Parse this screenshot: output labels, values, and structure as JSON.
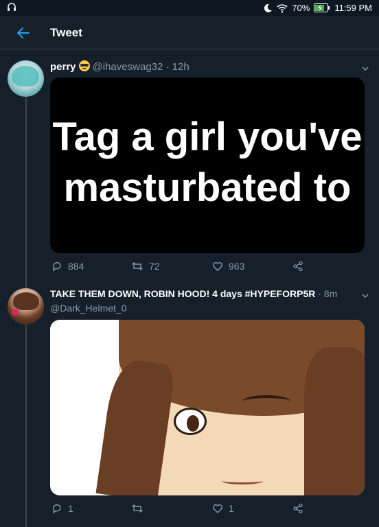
{
  "status": {
    "left_icon": "headphones-icon",
    "battery": "70%",
    "time": "11:59 PM"
  },
  "header": {
    "title": "Tweet"
  },
  "tweets": [
    {
      "name": "perry",
      "handle": "@ihaveswag32",
      "dot": "·",
      "time": "12h",
      "media_text": "Tag a girl you've masturbated to",
      "replies": "884",
      "retweets": "72",
      "likes": "963"
    },
    {
      "name": "TAKE THEM DOWN, ROBIN HOOD! 4 days #HYPEFORP5R",
      "dot": "·",
      "time": "8m",
      "handle": "@Dark_Helmet_0",
      "replies": "1",
      "retweets": "",
      "likes": "1"
    }
  ]
}
